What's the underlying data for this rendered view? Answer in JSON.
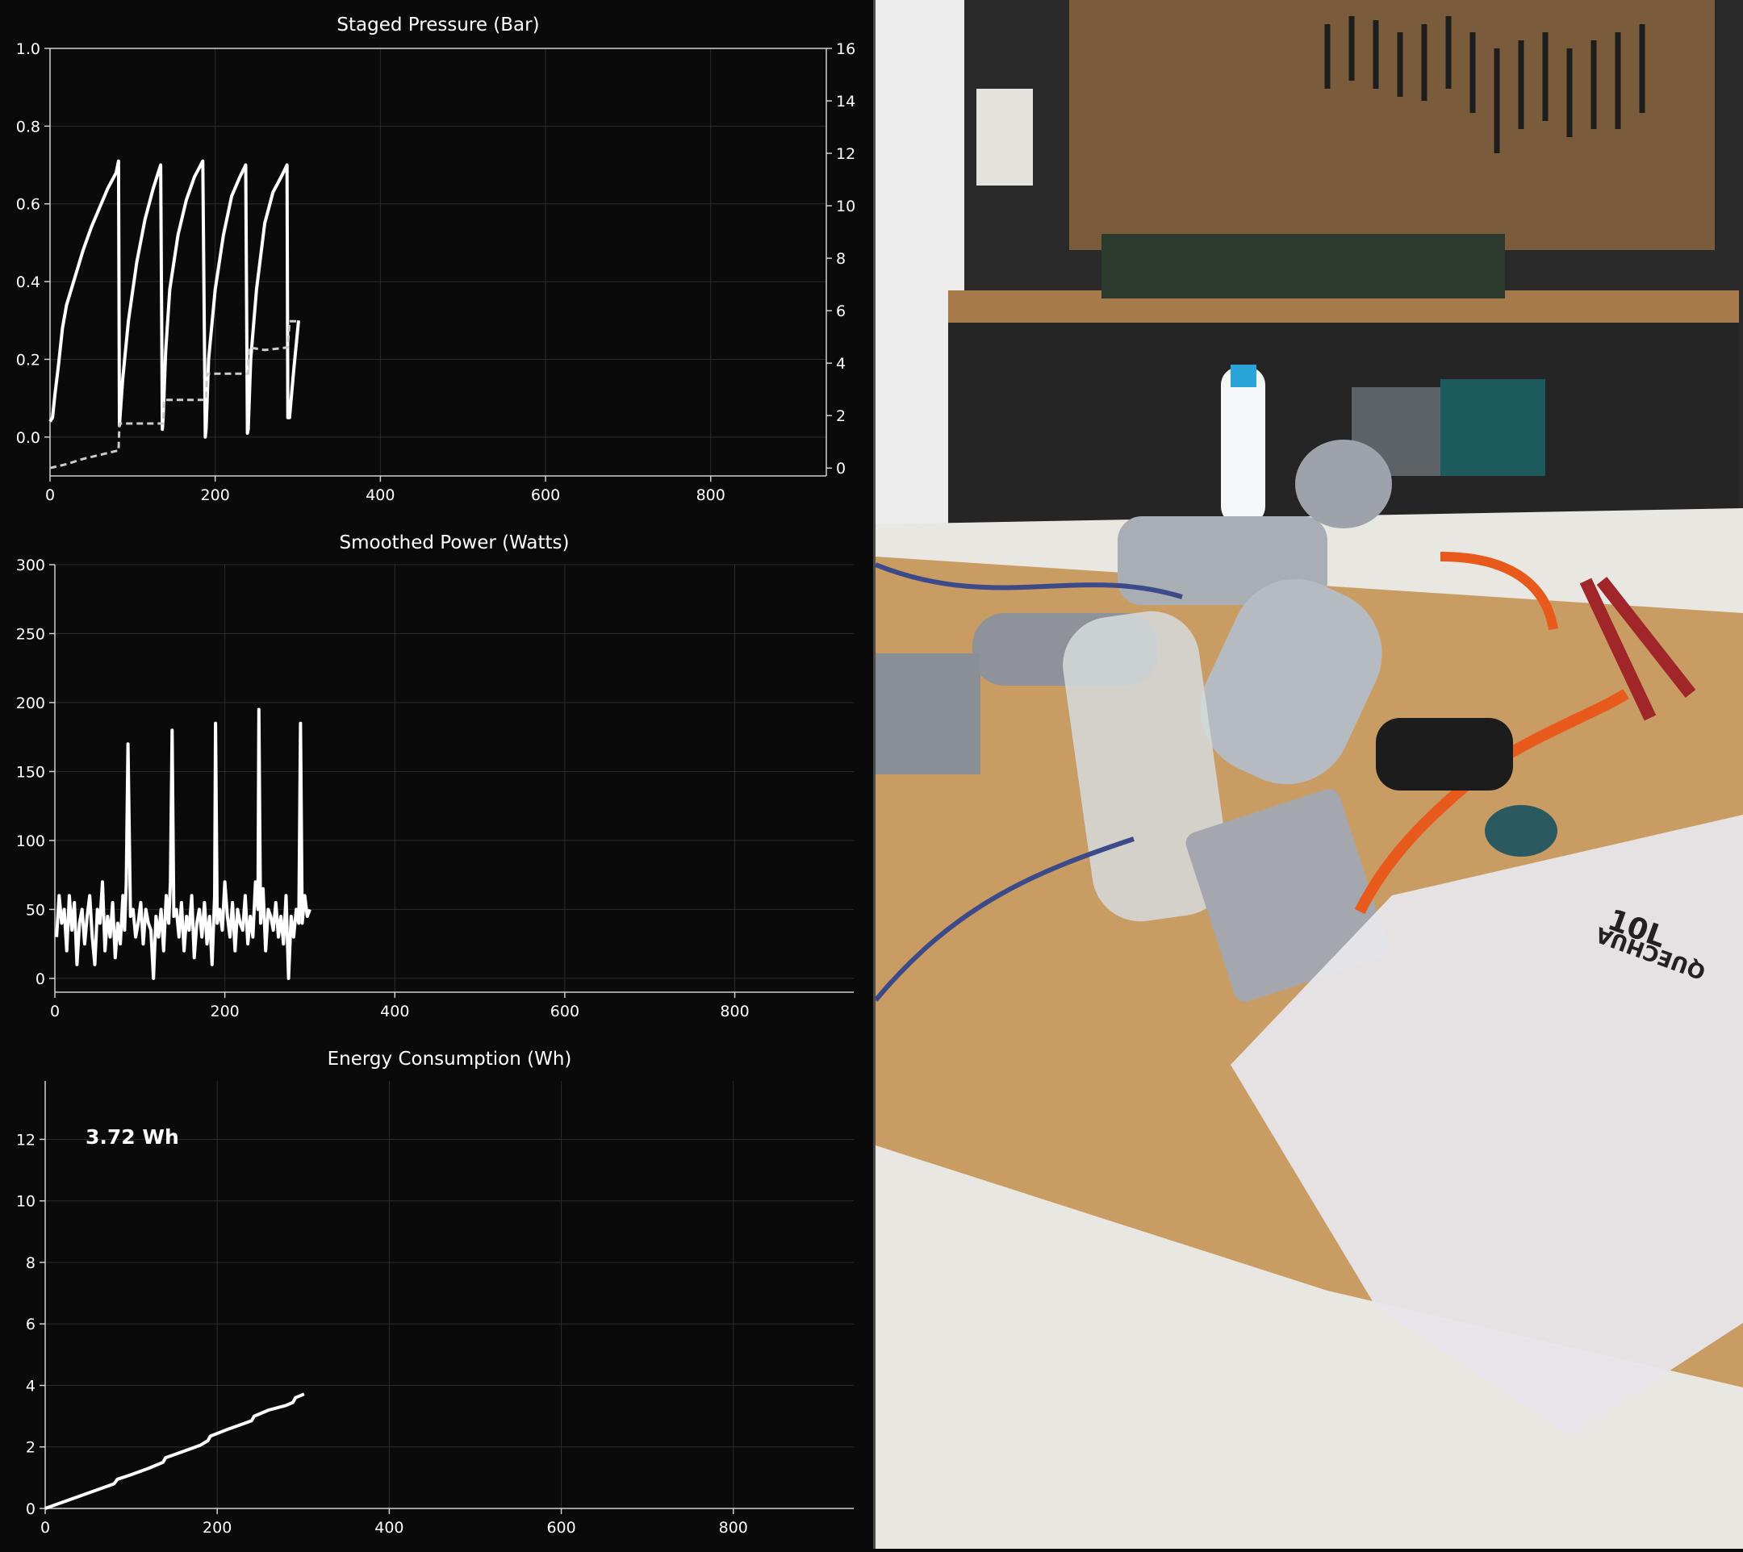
{
  "chart_data": [
    {
      "id": "pressure",
      "type": "line",
      "title": "Staged Pressure (Bar)",
      "xlabel": "",
      "ylabel": "",
      "xlim": [
        0,
        940
      ],
      "xticks": [
        0,
        200,
        400,
        600,
        800
      ],
      "ylim": [
        -0.1,
        1.0
      ],
      "yticks": [
        0.0,
        0.2,
        0.4,
        0.6,
        0.8,
        1.0
      ],
      "y2lim": [
        -0.3,
        16
      ],
      "y2ticks": [
        0,
        2,
        4,
        6,
        8,
        10,
        12,
        14,
        16
      ],
      "grid": true,
      "series": [
        {
          "axis": "left",
          "style": "solid",
          "x": [
            0,
            3,
            6,
            10,
            15,
            20,
            30,
            40,
            50,
            60,
            70,
            80,
            83,
            84,
            88,
            95,
            105,
            115,
            125,
            134,
            136,
            137,
            140,
            145,
            155,
            165,
            175,
            185,
            188,
            189,
            192,
            200,
            210,
            220,
            230,
            237,
            239,
            240,
            243,
            250,
            260,
            270,
            280,
            287,
            288,
            290,
            295,
            301
          ],
          "y": [
            0.04,
            0.05,
            0.11,
            0.18,
            0.28,
            0.34,
            0.41,
            0.48,
            0.54,
            0.59,
            0.64,
            0.68,
            0.71,
            0.03,
            0.15,
            0.3,
            0.45,
            0.56,
            0.64,
            0.7,
            0.02,
            0.05,
            0.22,
            0.38,
            0.52,
            0.61,
            0.67,
            0.71,
            0.0,
            0.02,
            0.2,
            0.38,
            0.52,
            0.62,
            0.67,
            0.7,
            0.01,
            0.02,
            0.2,
            0.38,
            0.55,
            0.63,
            0.67,
            0.7,
            0.05,
            0.05,
            0.17,
            0.3
          ]
        },
        {
          "axis": "right",
          "style": "dashed",
          "x": [
            0,
            20,
            40,
            60,
            80,
            83,
            84,
            100,
            137,
            138,
            150,
            189,
            190,
            210,
            240,
            241,
            260,
            288,
            290,
            301
          ],
          "y": [
            0.0,
            0.15,
            0.35,
            0.5,
            0.65,
            0.65,
            1.7,
            1.7,
            1.7,
            2.6,
            2.6,
            2.6,
            3.6,
            3.6,
            3.6,
            4.6,
            4.5,
            4.6,
            5.6,
            5.6
          ]
        }
      ]
    },
    {
      "id": "power",
      "type": "line",
      "title": "Smoothed Power (Watts)",
      "xlabel": "",
      "ylabel": "",
      "xlim": [
        0,
        940
      ],
      "xticks": [
        0,
        200,
        400,
        600,
        800
      ],
      "ylim": [
        -10,
        300
      ],
      "yticks": [
        0,
        50,
        100,
        150,
        200,
        250,
        300
      ],
      "grid": true,
      "series": [
        {
          "x": [
            2,
            5,
            8,
            11,
            14,
            17,
            20,
            23,
            26,
            29,
            32,
            35,
            38,
            41,
            44,
            47,
            50,
            53,
            56,
            59,
            62,
            65,
            68,
            71,
            74,
            77,
            80,
            82,
            84,
            86,
            89,
            92,
            95,
            98,
            101,
            104,
            107,
            110,
            113,
            116,
            119,
            122,
            125,
            128,
            131,
            134,
            136,
            138,
            140,
            143,
            146,
            149,
            152,
            155,
            158,
            161,
            164,
            167,
            170,
            173,
            176,
            179,
            182,
            185,
            188,
            189,
            191,
            194,
            197,
            200,
            203,
            206,
            209,
            212,
            215,
            218,
            221,
            224,
            227,
            230,
            233,
            236,
            239,
            240,
            242,
            245,
            248,
            251,
            254,
            257,
            260,
            263,
            266,
            269,
            272,
            275,
            278,
            281,
            284,
            287,
            289,
            291,
            294,
            297,
            300
          ],
          "y": [
            30,
            60,
            40,
            50,
            20,
            60,
            35,
            55,
            10,
            40,
            50,
            25,
            45,
            60,
            30,
            10,
            50,
            40,
            70,
            20,
            45,
            30,
            55,
            15,
            40,
            25,
            60,
            35,
            70,
            170,
            45,
            50,
            30,
            40,
            55,
            25,
            50,
            40,
            35,
            0,
            45,
            30,
            50,
            20,
            60,
            40,
            70,
            180,
            45,
            50,
            30,
            55,
            20,
            45,
            35,
            60,
            15,
            40,
            50,
            30,
            55,
            25,
            45,
            10,
            60,
            185,
            40,
            50,
            35,
            70,
            45,
            30,
            55,
            20,
            50,
            40,
            35,
            60,
            25,
            45,
            30,
            70,
            50,
            195,
            40,
            65,
            20,
            50,
            45,
            35,
            55,
            30,
            45,
            25,
            60,
            0,
            45,
            30,
            50,
            40,
            185,
            40,
            60,
            45,
            50
          ]
        }
      ]
    },
    {
      "id": "energy",
      "type": "line",
      "title": "Energy Consumption (Wh)",
      "xlabel": "",
      "ylabel": "",
      "xlim": [
        0,
        940
      ],
      "xticks": [
        0,
        200,
        400,
        600,
        800
      ],
      "ylim": [
        0,
        13.9
      ],
      "yticks": [
        0,
        2,
        4,
        6,
        8,
        10,
        12
      ],
      "grid": true,
      "annotation": "3.72 Wh",
      "series": [
        {
          "x": [
            0,
            20,
            40,
            60,
            80,
            84,
            100,
            120,
            137,
            140,
            160,
            180,
            189,
            192,
            210,
            230,
            240,
            243,
            260,
            280,
            288,
            291,
            301
          ],
          "y": [
            0.0,
            0.2,
            0.4,
            0.6,
            0.8,
            0.95,
            1.1,
            1.3,
            1.5,
            1.65,
            1.85,
            2.05,
            2.2,
            2.35,
            2.55,
            2.75,
            2.85,
            3.0,
            3.2,
            3.35,
            3.45,
            3.6,
            3.72
          ]
        }
      ]
    }
  ],
  "photo": {
    "description_icon": "workshop-photo",
    "colors": {
      "pegboard": "#7a5a3a",
      "table": "#c89a62",
      "tablecloth": "#e8e6e0",
      "wall": "#2a2a2c",
      "tank": "#b8bcc4",
      "hose": "#e85a1c"
    },
    "bag_print": "10L",
    "bag_brand": "QUECHUA"
  },
  "theme": {
    "background": "#0a0a0a",
    "line": "#ffffff",
    "dashed": "#cccccc",
    "grid": "#2c2c2c",
    "axis": "#d0d0d0"
  }
}
